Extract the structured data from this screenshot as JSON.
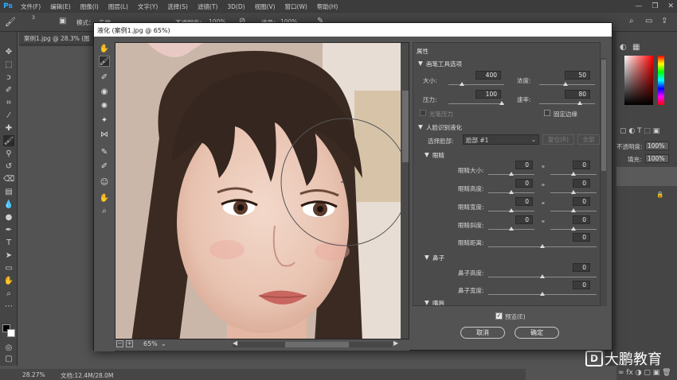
{
  "menubar": {
    "logo": "Ps",
    "items": [
      "文件(F)",
      "编辑(E)",
      "图像(I)",
      "图层(L)",
      "文字(Y)",
      "选择(S)",
      "滤镜(T)",
      "3D(D)",
      "视图(V)",
      "窗口(W)",
      "帮助(H)"
    ],
    "controls": [
      "—",
      "❐",
      "✕"
    ]
  },
  "optbar": {
    "mode_label": "模式：",
    "mode_value": "正常",
    "opacity_label": "不透明度：",
    "opacity_value": "100%",
    "flow_label": "流量：",
    "flow_value": "100%",
    "brush_size": "3"
  },
  "document": {
    "tab_label": "案例1.jpg @ 28.3% (图",
    "status_zoom": "28.27%",
    "status_doc": "文档:12.4M/28.0M"
  },
  "right_panel": {
    "opacity_label": "不透明度:",
    "opacity_value": "100%",
    "fill_label": "填充:",
    "fill_value": "100%"
  },
  "watermark": {
    "icon": "D",
    "text": "大鹏教育"
  },
  "dialog": {
    "title": "液化 (案例1.jpg @ 65%)",
    "zoom_value": "65%",
    "properties_title": "属性",
    "brush_section": "画笔工具选项",
    "size_label": "大小:",
    "size_value": "400",
    "density_label": "浓度:",
    "density_value": "50",
    "pressure_label": "压力:",
    "pressure_value": "100",
    "rate_label": "速率:",
    "rate_value": "80",
    "stylus_label": "光笔压力",
    "pin_edges_label": "固定边缘",
    "face_section": "人脸识别液化",
    "select_face_label": "选择脸部:",
    "select_face_value": "脸部 #1",
    "reset_label": "复位(R)",
    "all_label": "全部",
    "eyes_section": "眼睛",
    "eye_size_label": "眼睛大小:",
    "eye_height_label": "眼睛高度:",
    "eye_width_label": "眼睛宽度:",
    "eye_tilt_label": "眼睛斜度:",
    "eye_distance_label": "眼睛距离:",
    "eye_value": "0",
    "nose_section": "鼻子",
    "nose_height_label": "鼻子高度:",
    "nose_width_label": "鼻子宽度:",
    "nose_value": "0",
    "mouth_section": "嘴唇",
    "preview_label": "预览(E)",
    "cancel_label": "取消",
    "ok_label": "确定"
  },
  "colors": {
    "app_bg": "#535353",
    "menubar_bg": "#3c3c3c",
    "ps_blue": "#31a8ff",
    "dialog_title_bg": "#ffffff"
  }
}
